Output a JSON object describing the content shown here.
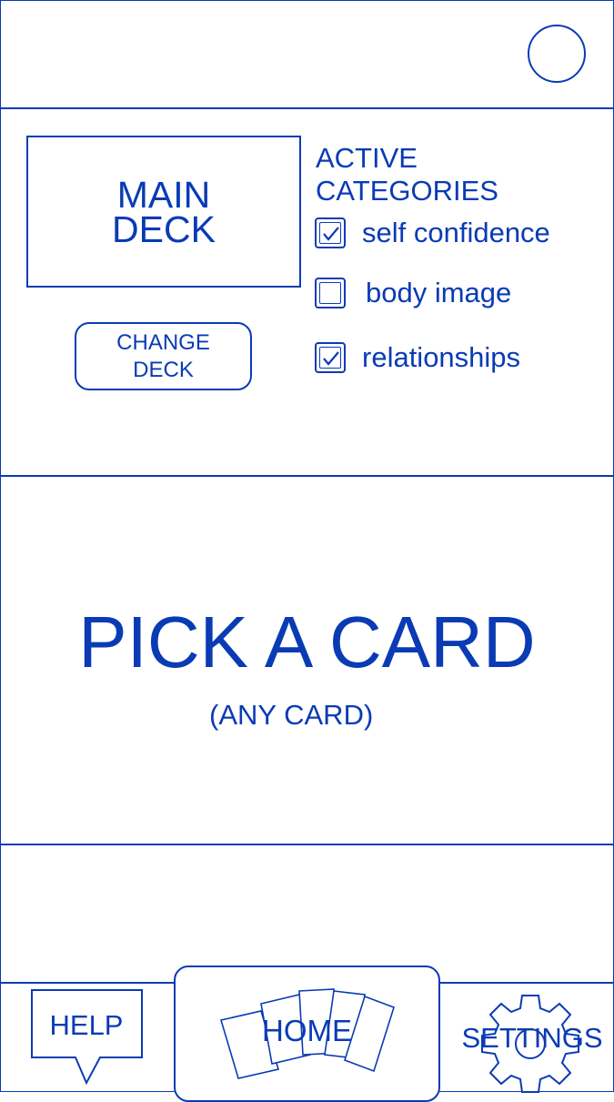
{
  "deck": {
    "title": "MAIN\nDECK",
    "change_button_label": "CHANGE\nDECK"
  },
  "categories": {
    "heading": "ACTIVE\nCATEGORIES",
    "items": [
      {
        "label": "self confidence",
        "checked": true
      },
      {
        "label": "body image",
        "checked": false
      },
      {
        "label": "relationships",
        "checked": true
      }
    ]
  },
  "main": {
    "title": "PICK A CARD",
    "subtitle": "(ANY CARD)"
  },
  "nav": {
    "help_label": "HELP",
    "home_label": "HOME",
    "settings_label": "SETTINGS"
  },
  "icons": {
    "profile": "user-circle-icon",
    "help": "speech-bubble-icon",
    "home": "cards-fan-icon",
    "settings": "gear-icon"
  },
  "colors": {
    "accent": "#0a3bb5",
    "background": "#ffffff"
  }
}
